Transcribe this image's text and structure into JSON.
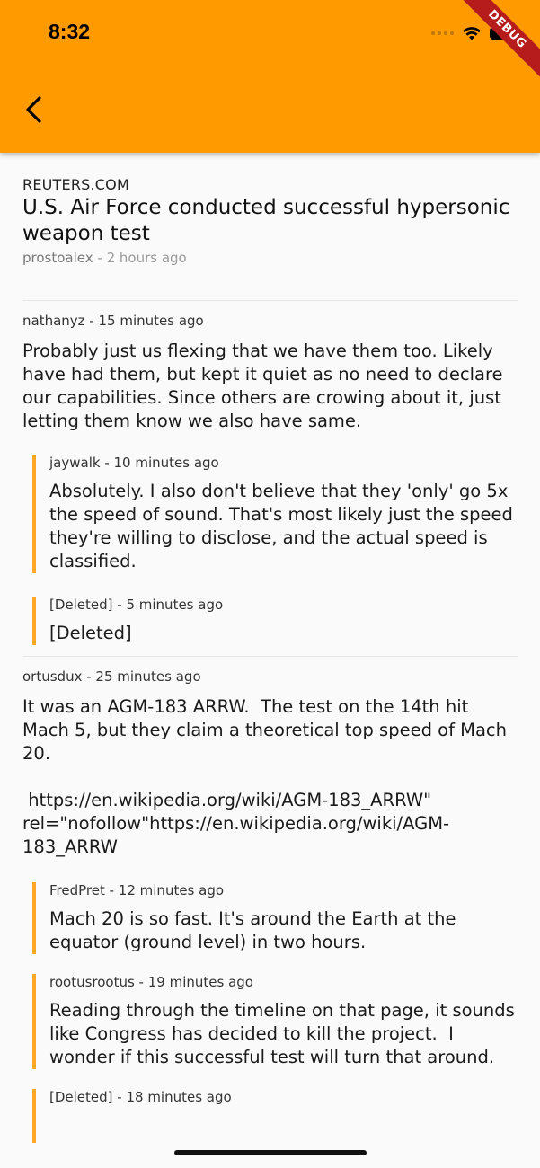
{
  "status": {
    "time": "8:32"
  },
  "debug_banner": "DEBUG",
  "story": {
    "source": "REUTERS.COM",
    "title": "U.S. Air Force conducted successful hypersonic weapon test",
    "author": "prostoalex",
    "age": "2 hours ago",
    "separator": " - "
  },
  "comments": [
    {
      "meta": "nathanyz - 15 minutes ago",
      "body": "Probably just us flexing that we have them too. Likely have had them, but kept it quiet as no need to declare our capabilities. Since others are crowing about it, just letting them know we also have same.",
      "replies": [
        {
          "meta": "jaywalk - 10 minutes ago",
          "body": "Absolutely. I also don't believe that they 'only' go 5x the speed of sound. That's most likely just the speed they're willing to disclose, and the actual speed is classified."
        },
        {
          "meta": "[Deleted] - 5 minutes ago",
          "body": "[Deleted]"
        }
      ]
    },
    {
      "meta": "ortusdux - 25 minutes ago",
      "body": "It was an AGM-183 ARRW.  The test on the 14th hit Mach 5, but they claim a theoretical top speed of Mach 20.\n\n https://en.wikipedia.org/wiki/AGM-183_ARRW\" rel=\"nofollow\"https://en.wikipedia.org/wiki/AGM-183_ARRW",
      "replies": [
        {
          "meta": "FredPret - 12 minutes ago",
          "body": "Mach 20 is so fast. It's around the Earth at the equator (ground level) in two hours."
        },
        {
          "meta": "rootusrootus - 19 minutes ago",
          "body": "Reading through the timeline on that page, it sounds like Congress has decided to kill the project.  I wonder if this successful test will turn that around."
        },
        {
          "meta": "[Deleted] - 18 minutes ago",
          "body": ""
        }
      ]
    }
  ],
  "colors": {
    "app_bar": "#FF9A00",
    "reply_bar": "#FFA726",
    "background": "#FAFAFA",
    "debug_ribbon": "#B71C1C"
  },
  "icons": {
    "back": "chevron-left-icon",
    "wifi": "wifi-icon",
    "battery": "battery-icon",
    "signal": "signal-icon"
  }
}
